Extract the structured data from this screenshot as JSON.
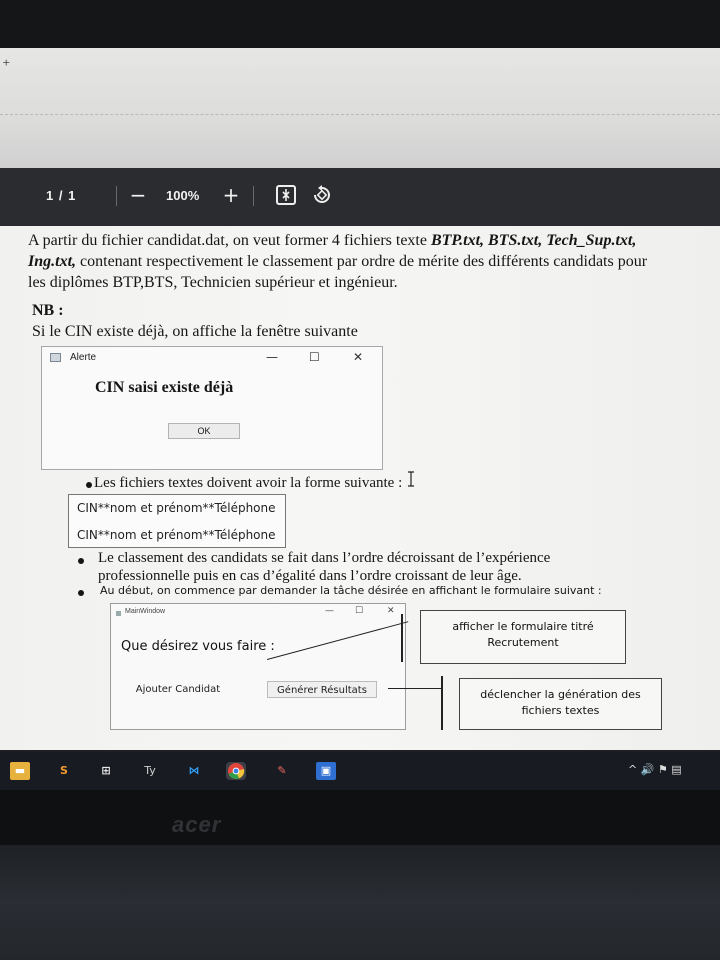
{
  "pdf_toolbar": {
    "page_info": "1 / 1",
    "zoom_out": "−",
    "zoom_level": "100%",
    "zoom_in": "+",
    "fit_icon": "fit-page-icon",
    "rotate_icon": "rotate-icon"
  },
  "document": {
    "intro_a": "A partir du fichier candidat.dat, on veut former 4 fichiers texte ",
    "file1": "BTP.txt, BTS.txt,",
    "file2": "Tech_Sup.txt, Ing.txt,",
    "intro_b": " contenant respectivement le classement par ordre de mérite des différents candidats pour les diplômes BTP,BTS, Technicien supérieur et ingénieur.",
    "nb_title": "NB :",
    "nb_text": "Si le CIN existe déjà, on affiche la fenêtre suivante",
    "alert_window": {
      "title": "Alerte",
      "minimize": "—",
      "maximize": "☐",
      "close": "✕",
      "message": "CIN saisi existe déjà",
      "ok_label": "OK"
    },
    "bullet1": "Les fichiers textes doivent avoir la forme suivante :",
    "format_lines": [
      "CIN**nom et prénom**Téléphone",
      "CIN**nom et prénom**Téléphone"
    ],
    "bullet2_line1": "Le classement des candidats se fait dans l’ordre décroissant de l’expérience",
    "bullet2_line2": "professionnelle puis en cas d’égalité dans l’ordre croissant de leur âge.",
    "bullet3": "Au début, on commence par demander la tâche désirée en affichant le formulaire suivant :",
    "main_window": {
      "title": "MainWindow",
      "minimize": "—",
      "maximize": "☐",
      "close": "✕",
      "question": "Que désirez vous faire :",
      "add_candidate": "Ajouter Candidat",
      "generate_results": "Générer  Résultats"
    },
    "callout1": "afficher le formulaire titré Recrutement",
    "callout2": "déclencher la génération des fichiers textes"
  },
  "taskbar": {
    "icons": [
      "file-explorer-icon",
      "sublime-icon",
      "store-icon",
      "typora-icon",
      "vscode-icon",
      "chrome-icon",
      "paint-icon",
      "app-icon"
    ],
    "tray": "^ 🔊 ⚑ ▤"
  },
  "monitor_brand": "acer",
  "colors": {
    "toolbar": "#2b2c2f",
    "taskbar": "#191b22",
    "page": "#f3f3f1"
  }
}
